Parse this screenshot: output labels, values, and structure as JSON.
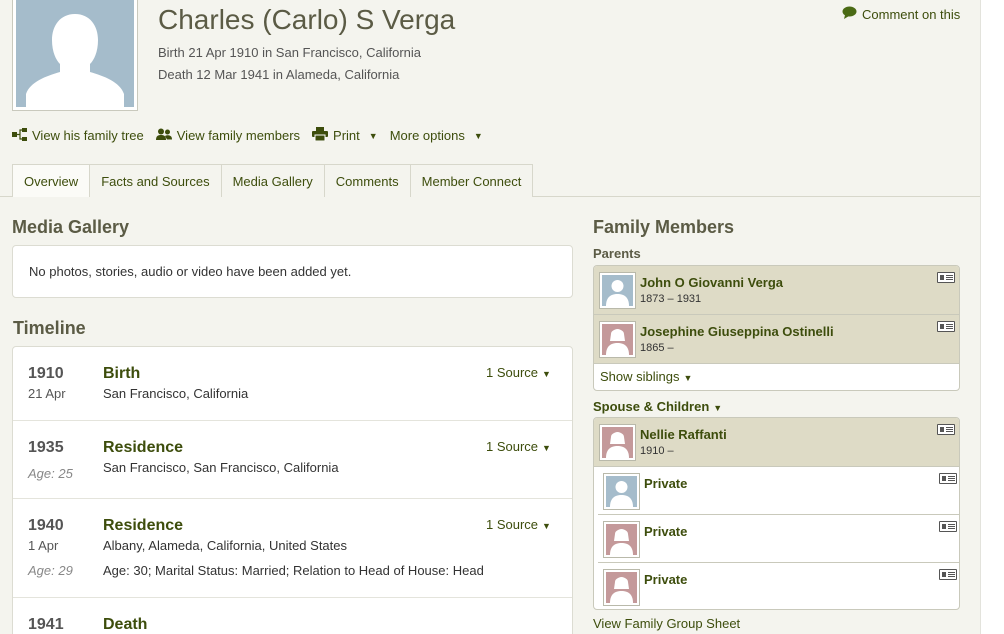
{
  "profile": {
    "name": "Charles (Carlo) S Verga",
    "birth": "Birth 21 Apr 1910 in San Francisco, California",
    "death": "Death 12 Mar 1941 in Alameda, California",
    "comment_link": "Comment on this"
  },
  "actions": {
    "family_tree": "View his family tree",
    "family_members": "View family members",
    "print": "Print",
    "more_options": "More options"
  },
  "tabs": [
    "Overview",
    "Facts and Sources",
    "Media Gallery",
    "Comments",
    "Member Connect"
  ],
  "media_gallery": {
    "title": "Media Gallery",
    "empty_text": "No photos, stories, audio or video have been added yet."
  },
  "timeline": {
    "title": "Timeline",
    "events": [
      {
        "year": "1910",
        "sub": "21 Apr",
        "age": "",
        "event": "Birth",
        "place": "San Francisco, California",
        "detail": "",
        "source": "1 Source"
      },
      {
        "year": "1935",
        "sub": "",
        "age": "Age: 25",
        "event": "Residence",
        "place": "San Francisco, San Francisco, California",
        "detail": "",
        "source": "1 Source"
      },
      {
        "year": "1940",
        "sub": "1 Apr",
        "age": "Age: 29",
        "event": "Residence",
        "place": "Albany, Alameda, California, United States",
        "detail": "Age: 30; Marital Status: Married; Relation to Head of House: Head",
        "source": "1 Source"
      },
      {
        "year": "1941",
        "sub": "",
        "age": "",
        "event": "Death",
        "place": "",
        "detail": "",
        "source": ""
      }
    ]
  },
  "family": {
    "title": "Family Members",
    "parents_label": "Parents",
    "parents": [
      {
        "name": "John O Giovanni Verga",
        "dates": "1873 – 1931",
        "gender": "male"
      },
      {
        "name": "Josephine Giuseppina Ostinelli",
        "dates": "1865 –",
        "gender": "female"
      }
    ],
    "show_siblings": "Show siblings",
    "spouse_label": "Spouse & Children",
    "spouse": {
      "name": "Nellie Raffanti",
      "dates": "1910 –",
      "gender": "female"
    },
    "children": [
      {
        "name": "Private",
        "gender": "male"
      },
      {
        "name": "Private",
        "gender": "female"
      },
      {
        "name": "Private",
        "gender": "female"
      }
    ],
    "group_sheet": "View Family Group Sheet"
  },
  "colors": {
    "link_green": "#3d4d0c",
    "male_silhouette_bg": "#a5bccb",
    "female_silhouette_bg": "#c4999a",
    "highlight_row": "#dedbc6"
  }
}
